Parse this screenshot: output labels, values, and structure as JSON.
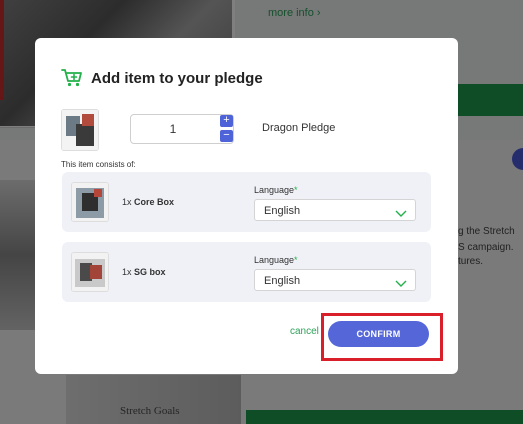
{
  "background": {
    "more_info": "more info",
    "text_lines": [
      "g the Stretch",
      "S campaign.",
      "tures."
    ],
    "sg_box_text": "Stretch Goals"
  },
  "modal": {
    "title": "Add item to your pledge",
    "quantity": "1",
    "pledge_name": "Dragon Pledge",
    "consists_label": "This item consists of:",
    "items": [
      {
        "qty": "1x",
        "name": "Core Box",
        "language_label": "Language",
        "language_value": "English"
      },
      {
        "qty": "1x",
        "name": "SG box",
        "language_label": "Language",
        "language_value": "English"
      }
    ],
    "cancel_label": "cancel",
    "confirm_label": "CONFIRM"
  },
  "icons": {
    "cart": "cart-plus-icon",
    "plus": "plus-icon",
    "minus": "minus-icon",
    "chevron": "chevron-down-icon"
  },
  "colors": {
    "accent_blue": "#5566d9",
    "accent_green": "#22b04a",
    "highlight_red": "#d9202a"
  }
}
